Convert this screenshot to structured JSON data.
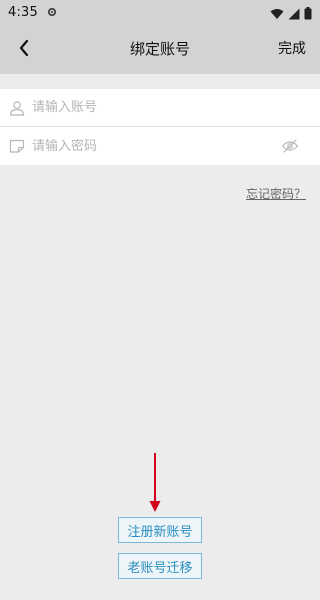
{
  "status_bar": {
    "time": "4:35",
    "gear_icon": "settings-gear-icon",
    "wifi_icon": "wifi-icon",
    "signal_icon": "cell-signal-icon",
    "battery_icon": "battery-icon"
  },
  "toolbar": {
    "back_icon": "chevron-left-icon",
    "title": "绑定账号",
    "done_label": "完成"
  },
  "form": {
    "account": {
      "icon": "user-icon",
      "placeholder": "请输入账号",
      "value": ""
    },
    "password": {
      "icon": "note-icon",
      "placeholder": "请输入密码",
      "value": "",
      "toggle_icon": "eye-off-icon"
    }
  },
  "links": {
    "forgot_password": "忘记密码？"
  },
  "actions": {
    "register_label": "注册新账号",
    "migrate_label": "老账号迁移"
  },
  "colors": {
    "background": "#ececec",
    "header": "#d3d3d3",
    "accent_blue": "#2a8ec0",
    "arrow_red": "#d0021b"
  }
}
